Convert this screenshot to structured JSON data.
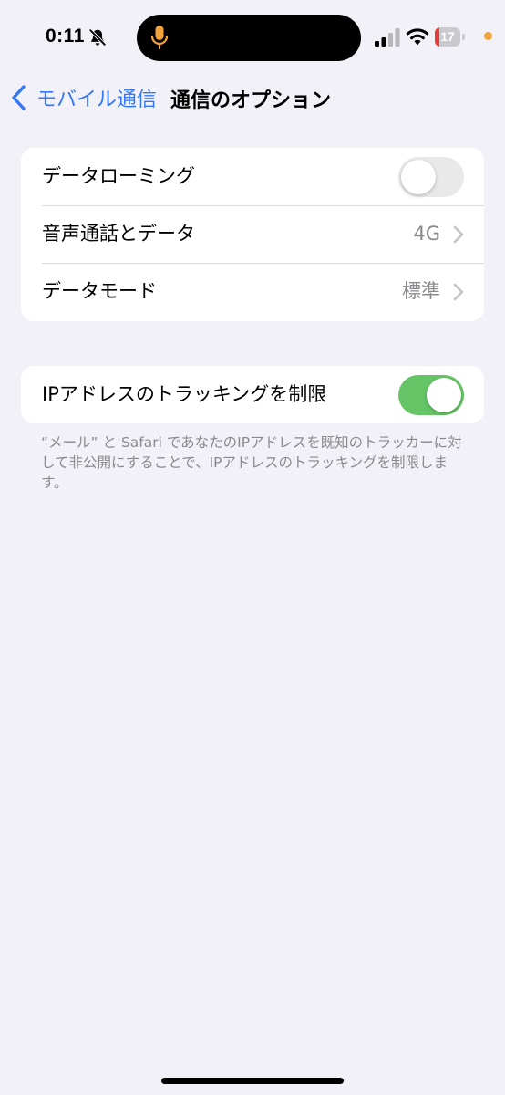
{
  "status_bar": {
    "time": "0:11",
    "battery_level": "17",
    "battery_fraction": 0.17,
    "accent_mic_color": "#f2a33c",
    "icons": [
      "bell-slash-icon",
      "mic-icon",
      "signal-icon",
      "wifi-icon",
      "battery-icon"
    ]
  },
  "nav": {
    "back_label": "モバイル通信",
    "title": "通信のオプション",
    "accent_color": "#3478f6"
  },
  "group1": {
    "rows": [
      {
        "label": "データローミング",
        "control": "toggle",
        "on": false
      },
      {
        "label": "音声通話とデータ",
        "value": "4G",
        "control": "chevron"
      },
      {
        "label": "データモード",
        "value": "標準",
        "control": "chevron"
      }
    ]
  },
  "group2": {
    "rows": [
      {
        "label": "IPアドレスのトラッキングを制限",
        "control": "toggle",
        "on": true,
        "on_color": "#65c466"
      }
    ],
    "footnote": "“メール” と Safari であなたのIPアドレスを既知のトラッカーに対して非公開にすることで、IPアドレスのトラッキングを制限します。"
  }
}
